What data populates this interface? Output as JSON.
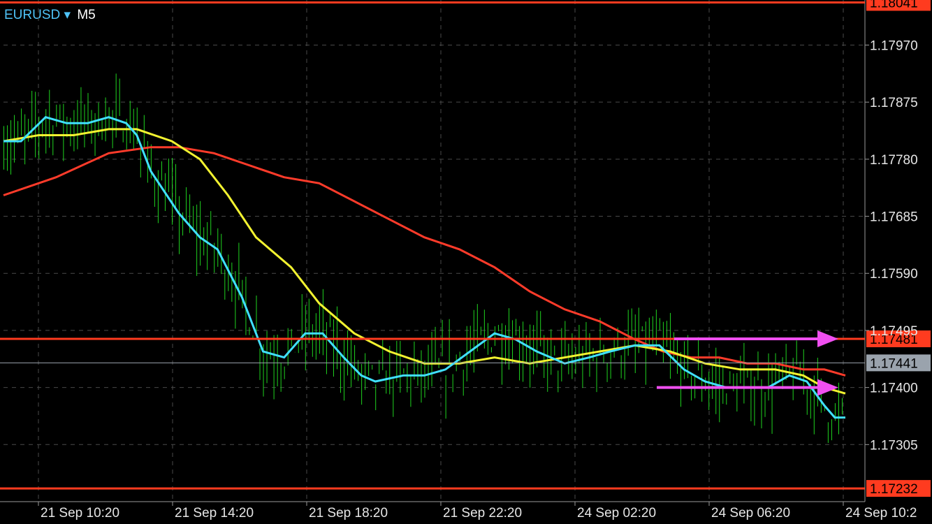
{
  "header": {
    "symbol": "EURUSD",
    "dropdown_glyph": "▾",
    "timeframe": "M5"
  },
  "colors": {
    "background": "#000000",
    "grid": "#4a4a4a",
    "candles": "#1fd31f",
    "ma_fast": "#40e0ff",
    "ma_mid": "#f2f230",
    "ma_slow": "#ff3b2a",
    "hline": "#ff3b1f",
    "arrow": "#f04ff0",
    "current_price_box": "#9aa3ad",
    "axis_text": "#e6e6e6"
  },
  "chart_data": {
    "type": "candlestick",
    "y_ticks": [
      "1.17970",
      "1.17875",
      "1.17780",
      "1.17685",
      "1.17590",
      "1.17495",
      "1.17400",
      "1.17305"
    ],
    "x_ticks": [
      "21 Sep 10:20",
      "21 Sep 14:20",
      "21 Sep 18:20",
      "21 Sep 22:20",
      "24 Sep 02:20",
      "24 Sep 06:20",
      "24 Sep 10:2"
    ],
    "ylim": [
      1.1721,
      1.18045
    ],
    "horizontal_lines": [
      {
        "price": 1.18041,
        "label": "1.18041"
      },
      {
        "price": 1.17481,
        "label": "1.17481"
      },
      {
        "price": 1.17232,
        "label": "1.17232"
      }
    ],
    "current_price": {
      "price": 1.17441,
      "label": "1.17441"
    },
    "arrows": [
      {
        "from_time": "24 Sep 02:40",
        "to_time": "24 Sep 10:00",
        "price": 1.17481
      },
      {
        "from_time": "24 Sep 02:20",
        "to_time": "24 Sep 10:00",
        "price": 1.174
      }
    ],
    "bars_count": 240,
    "ma_fast": [
      [
        0,
        1.1781
      ],
      [
        5,
        1.1781
      ],
      [
        12,
        1.1785
      ],
      [
        18,
        1.1784
      ],
      [
        24,
        1.1784
      ],
      [
        30,
        1.1785
      ],
      [
        35,
        1.1784
      ],
      [
        38,
        1.1782
      ],
      [
        42,
        1.1776
      ],
      [
        50,
        1.1769
      ],
      [
        56,
        1.1765
      ],
      [
        61,
        1.1763
      ],
      [
        68,
        1.1755
      ],
      [
        74,
        1.1746
      ],
      [
        80,
        1.1745
      ],
      [
        86,
        1.1749
      ],
      [
        91,
        1.1749
      ],
      [
        97,
        1.1745
      ],
      [
        102,
        1.1742
      ],
      [
        106,
        1.1741
      ],
      [
        114,
        1.1742
      ],
      [
        120,
        1.1742
      ],
      [
        126,
        1.1743
      ],
      [
        133,
        1.1746
      ],
      [
        140,
        1.1749
      ],
      [
        146,
        1.1748
      ],
      [
        152,
        1.1746
      ],
      [
        160,
        1.1744
      ],
      [
        167,
        1.1745
      ],
      [
        173,
        1.1746
      ],
      [
        180,
        1.1747
      ],
      [
        187,
        1.1747
      ],
      [
        194,
        1.1743
      ],
      [
        200,
        1.1741
      ],
      [
        206,
        1.174
      ],
      [
        212,
        1.174
      ],
      [
        218,
        1.174
      ],
      [
        224,
        1.1742
      ],
      [
        229,
        1.1741
      ],
      [
        234,
        1.1737
      ],
      [
        237,
        1.1735
      ],
      [
        240,
        1.1735
      ]
    ],
    "ma_mid": [
      [
        0,
        1.1781
      ],
      [
        10,
        1.1782
      ],
      [
        20,
        1.1782
      ],
      [
        30,
        1.1783
      ],
      [
        38,
        1.1783
      ],
      [
        48,
        1.1781
      ],
      [
        56,
        1.1778
      ],
      [
        64,
        1.1772
      ],
      [
        72,
        1.1765
      ],
      [
        82,
        1.176
      ],
      [
        90,
        1.1754
      ],
      [
        100,
        1.1749
      ],
      [
        110,
        1.1746
      ],
      [
        120,
        1.1744
      ],
      [
        130,
        1.1744
      ],
      [
        140,
        1.1745
      ],
      [
        150,
        1.1744
      ],
      [
        160,
        1.1745
      ],
      [
        170,
        1.1746
      ],
      [
        180,
        1.1747
      ],
      [
        190,
        1.1746
      ],
      [
        200,
        1.1744
      ],
      [
        210,
        1.1743
      ],
      [
        220,
        1.1743
      ],
      [
        228,
        1.1742
      ],
      [
        234,
        1.174
      ],
      [
        240,
        1.1739
      ]
    ],
    "ma_slow": [
      [
        0,
        1.1772
      ],
      [
        15,
        1.1775
      ],
      [
        30,
        1.1779
      ],
      [
        42,
        1.178
      ],
      [
        50,
        1.178
      ],
      [
        60,
        1.1779
      ],
      [
        70,
        1.1777
      ],
      [
        80,
        1.1775
      ],
      [
        90,
        1.1774
      ],
      [
        100,
        1.1771
      ],
      [
        110,
        1.1768
      ],
      [
        120,
        1.1765
      ],
      [
        130,
        1.1763
      ],
      [
        140,
        1.176
      ],
      [
        150,
        1.1756
      ],
      [
        160,
        1.1753
      ],
      [
        170,
        1.1751
      ],
      [
        180,
        1.1748
      ],
      [
        188,
        1.1746
      ],
      [
        196,
        1.1745
      ],
      [
        204,
        1.1745
      ],
      [
        212,
        1.1744
      ],
      [
        220,
        1.1744
      ],
      [
        228,
        1.1743
      ],
      [
        234,
        1.1743
      ],
      [
        240,
        1.1742
      ]
    ]
  }
}
